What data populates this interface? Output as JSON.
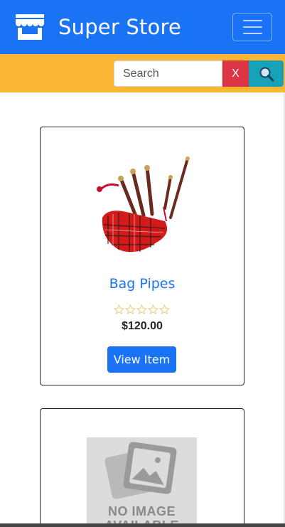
{
  "navbar": {
    "brand": "Super Store",
    "brand_icon": "store-icon",
    "toggler_icon": "hamburger-icon",
    "bg_color": "#1a73f5"
  },
  "search": {
    "placeholder": "Search",
    "clear_label": "X",
    "search_icon": "magnifier-icon",
    "bar_color": "#fbb733"
  },
  "products": [
    {
      "title": "Bag Pipes",
      "price": "$120.00",
      "rating": 0,
      "rating_max": 5,
      "view_label": "View Item",
      "image": "bagpipes-image"
    },
    {
      "image": "no-image-placeholder",
      "image_text": "NO IMAGE AVAILABLE"
    }
  ]
}
